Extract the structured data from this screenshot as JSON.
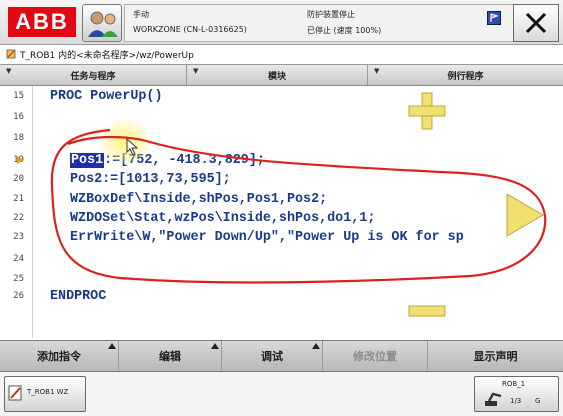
{
  "header": {
    "logo_text": "ABB",
    "status": {
      "mode": "手动",
      "system": "WORKZONE (CN-L-0316625)",
      "guard": "防护装置停止",
      "state": "已停止 (速度 100%)"
    }
  },
  "breadcrumb": "T_ROB1 内的<未命名程序>/wz/PowerUp",
  "tabs": [
    {
      "label": "任务与程序"
    },
    {
      "label": "模块"
    },
    {
      "label": "例行程序"
    }
  ],
  "code_lines": [
    {
      "num": "15",
      "code": "PROC PowerUp()"
    },
    {
      "num": "16",
      "code": ""
    },
    {
      "num": "18",
      "code": ""
    },
    {
      "num": "19",
      "selected": "Pos1",
      "code": ":=[752, -418.3,829];"
    },
    {
      "num": "20",
      "code": "Pos2:=[1013,73,595];"
    },
    {
      "num": "21",
      "code": "WZBoxDef\\Inside,shPos,Pos1,Pos2;"
    },
    {
      "num": "22",
      "code": "WZDOSet\\Stat,wzPos\\Inside,shPos,do1,1;"
    },
    {
      "num": "23",
      "code": "ErrWrite\\W,\"Power Down/Up\",\"Power Up is OK for sp"
    },
    {
      "num": "24",
      "code": ""
    },
    {
      "num": "25",
      "code": ""
    },
    {
      "num": "26",
      "code": "ENDPROC"
    }
  ],
  "commands": [
    {
      "label": "添加指令",
      "enabled": true
    },
    {
      "label": "编辑",
      "enabled": true
    },
    {
      "label": "调试",
      "enabled": true
    },
    {
      "label": "修改位置",
      "enabled": false
    },
    {
      "label": "显示声明",
      "enabled": true
    }
  ],
  "taskbar": {
    "task_label": "T_ROB1 WZ",
    "rob_label": "ROB_1",
    "rob_value": "1/3",
    "rob_value2": "G"
  },
  "colors": {
    "brand": "#e30613",
    "code_text": "#1a3a8a",
    "selection": "#1b2fa8",
    "annotation": "#e02020",
    "zoom_icons": "#f1e070"
  }
}
